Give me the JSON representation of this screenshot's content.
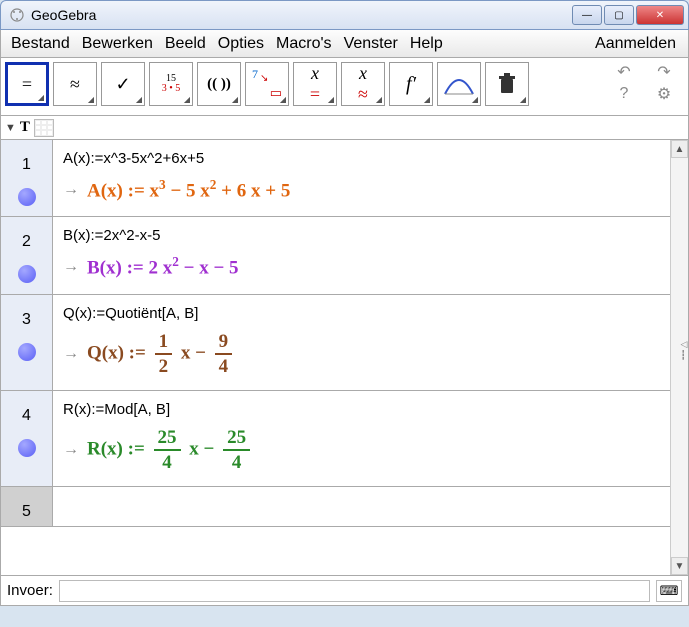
{
  "window": {
    "title": "GeoGebra"
  },
  "menu": {
    "items": [
      "Bestand",
      "Bewerken",
      "Beeld",
      "Opties",
      "Macro's",
      "Venster",
      "Help"
    ],
    "login": "Aanmelden"
  },
  "toolbar": {
    "tools": [
      {
        "name": "equals",
        "glyph": "=",
        "selected": true
      },
      {
        "name": "approx",
        "glyph": "≈"
      },
      {
        "name": "check",
        "glyph": "✓"
      },
      {
        "name": "eval-pt",
        "top": "15",
        "bottom": "3 • 5"
      },
      {
        "name": "parens",
        "glyph": "( ( ) )"
      },
      {
        "name": "sub",
        "glyph": "7"
      },
      {
        "name": "x-equals",
        "glyph": "x ="
      },
      {
        "name": "x-approx",
        "glyph": "x ≈"
      },
      {
        "name": "deriv",
        "glyph": "f′"
      },
      {
        "name": "dist",
        "glyph": "◠"
      },
      {
        "name": "delete",
        "glyph": "🗑"
      }
    ],
    "undo": "↶",
    "redo": "↷",
    "help": "?",
    "gear": "⚙"
  },
  "subbar": {
    "arrow": "▼",
    "T": "T"
  },
  "cas": {
    "rows": [
      {
        "n": "1",
        "input": "A(x):=x^3-5x^2+6x+5",
        "out_prefix": "A(x) := ",
        "out_html": "x<sup>3</sup> − 5 x<sup>2</sup> + 6 x + 5",
        "cls": "orange"
      },
      {
        "n": "2",
        "input": "B(x):=2x^2-x-5",
        "out_prefix": "B(x) := ",
        "out_html": "2 x<sup>2</sup> − x − 5",
        "cls": "purple"
      },
      {
        "n": "3",
        "input": "Q(x):=Quotiënt[A, B]",
        "out_prefix": "Q(x) := ",
        "out_html": "<span class='frac'><span class='n'>1</span><span class='d'>2</span></span> x − <span class='frac'><span class='n'>9</span><span class='d'>4</span></span>",
        "cls": "brown"
      },
      {
        "n": "4",
        "input": "R(x):=Mod[A, B]",
        "out_prefix": "R(x) := ",
        "out_html": "<span class='frac'><span class='n'>25</span><span class='d'>4</span></span> x − <span class='frac'><span class='n'>25</span><span class='d'>4</span></span>",
        "cls": "green"
      }
    ],
    "empty_row": "5"
  },
  "inputbar": {
    "label": "Invoer:",
    "kb": "⌨"
  }
}
